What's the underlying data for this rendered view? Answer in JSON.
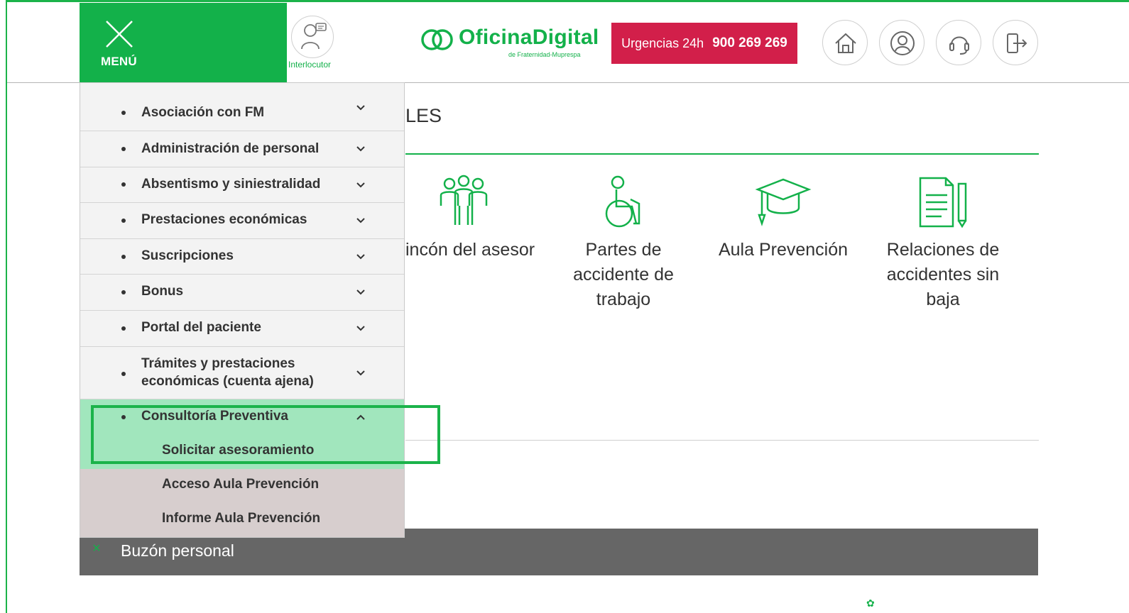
{
  "header": {
    "menu_label": "MENÚ",
    "interlocutor_label": "Interlocutor",
    "logo_brand": "OficinaDigital",
    "logo_sub": "de Fraternidad-Muprespa",
    "urgencias_label": "Urgencias 24h",
    "urgencias_phone": "900 269 269",
    "icons": [
      "home-icon",
      "user-icon",
      "headset-icon",
      "logout-icon"
    ]
  },
  "main": {
    "section_title_fragment": "LES",
    "cards": [
      {
        "label": "Rincón del asesor",
        "icon": "people-group-icon"
      },
      {
        "label": "Partes de accidente de trabajo",
        "icon": "wheelchair-icon"
      },
      {
        "label": "Aula Prevención",
        "icon": "graduation-cap-icon"
      },
      {
        "label": "Relaciones de accidentes sin baja",
        "icon": "document-pen-icon"
      }
    ],
    "buzon_label": "Buzón personal",
    "buzon_icon": "×"
  },
  "menu": {
    "items": [
      {
        "label": "Asociación con FM"
      },
      {
        "label": "Administración de personal"
      },
      {
        "label": "Absentismo y siniestralidad"
      },
      {
        "label": "Prestaciones económicas"
      },
      {
        "label": "Suscripciones"
      },
      {
        "label": "Bonus"
      },
      {
        "label": "Portal del paciente"
      },
      {
        "label": "Trámites y prestaciones económicas (cuenta ajena)"
      },
      {
        "label": "Consultoría Preventiva"
      }
    ],
    "subitems": [
      {
        "label": "Solicitar asesoramiento"
      },
      {
        "label": "Acceso Aula Prevención"
      },
      {
        "label": "Informe Aula Prevención"
      }
    ]
  },
  "colors": {
    "brand_green": "#13b14a",
    "urgent_red": "#d21f4a",
    "active_bg": "#a1e6bd",
    "submenu_bg": "#d7cece",
    "buzon_bg": "#666666"
  }
}
